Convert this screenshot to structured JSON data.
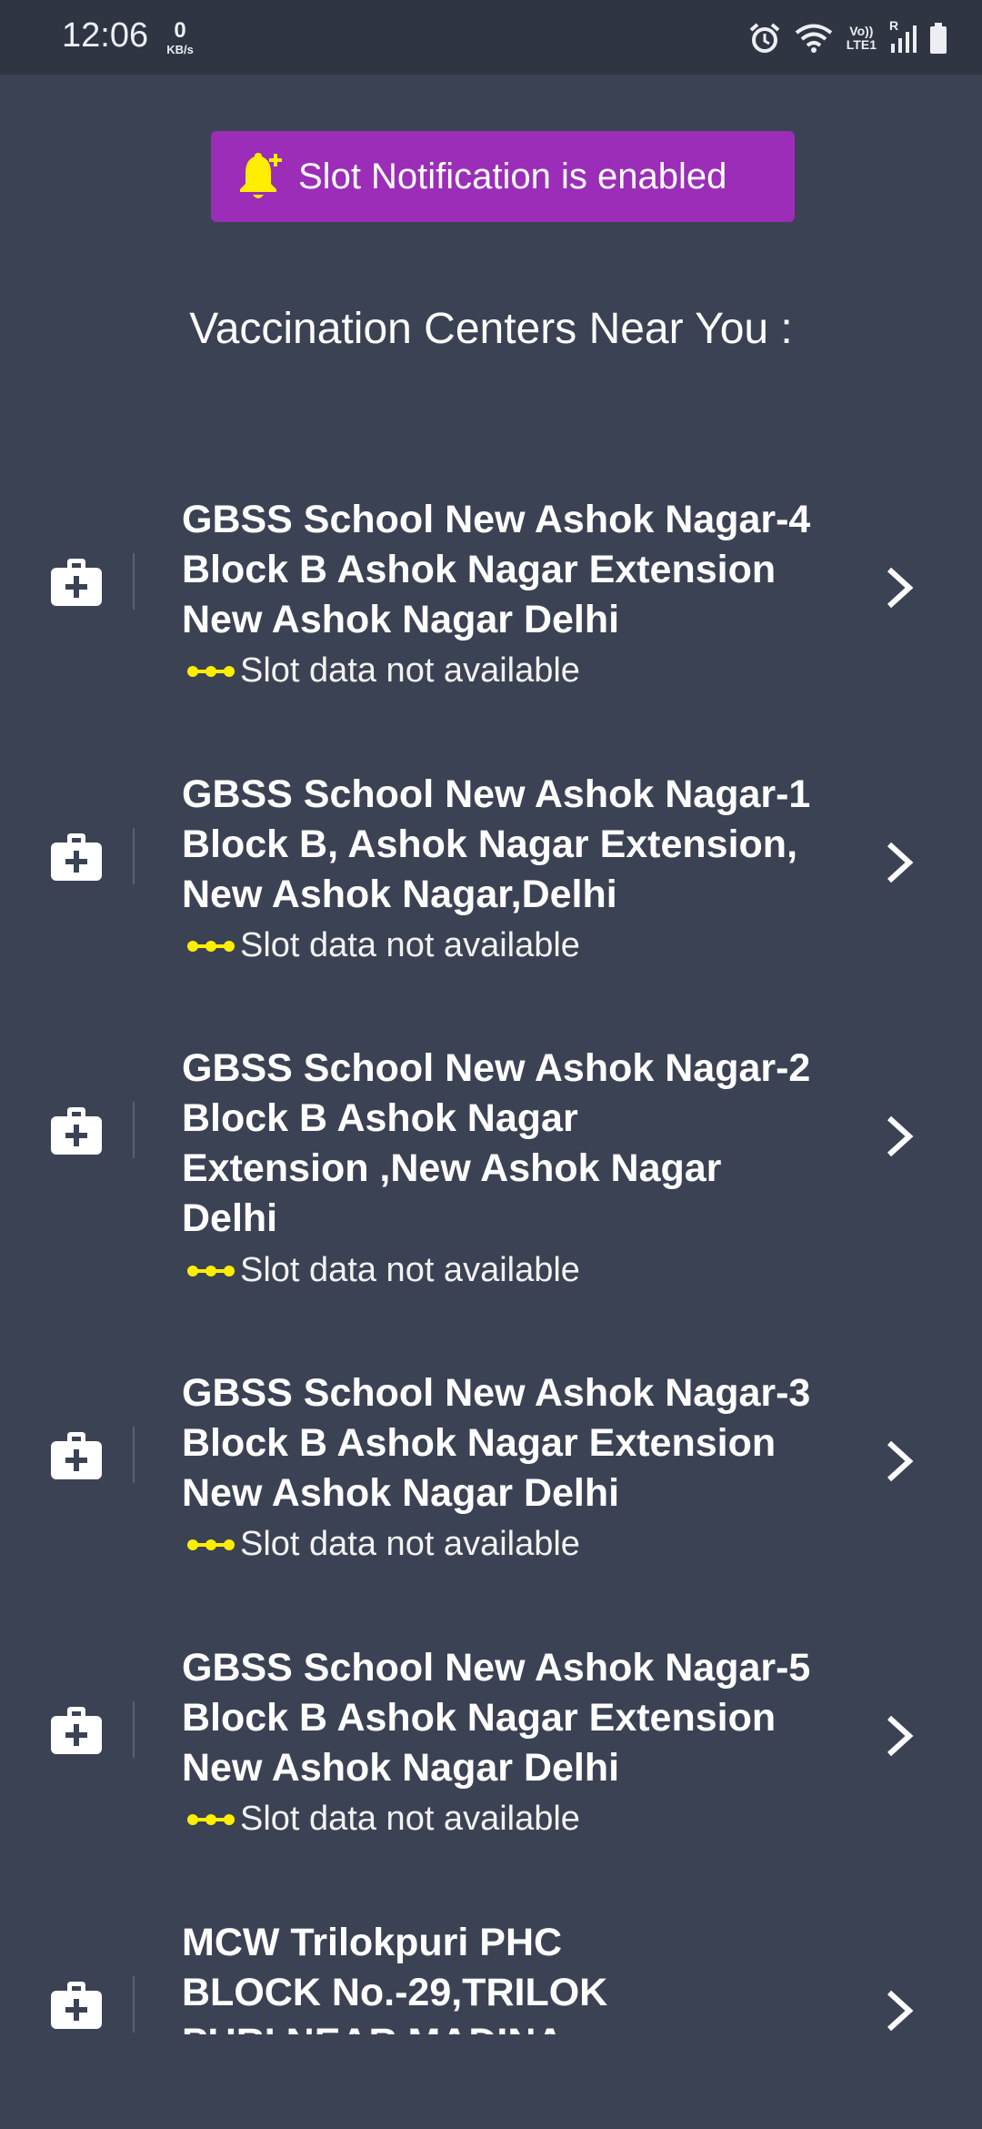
{
  "status_bar": {
    "time": "12:06",
    "net_speed_value": "0",
    "net_speed_unit": "KB/s",
    "network_label_top": "Vo))",
    "network_label_bottom": "LTE1",
    "roaming": "R",
    "icons": [
      "alarm-icon",
      "wifi-icon",
      "signal-icon",
      "battery-icon"
    ]
  },
  "notification": {
    "label": "Slot Notification is enabled",
    "icon": "bell-plus-icon",
    "bg_color": "#9b2db8",
    "icon_color": "#ffee00"
  },
  "section_title": "Vaccination Centers Near You :",
  "centers": [
    {
      "lines": [
        "GBSS School New Ashok Nagar-4",
        "Block B Ashok Nagar Extension",
        "New Ashok Nagar Delhi"
      ],
      "status": "Slot data not available"
    },
    {
      "lines": [
        "GBSS School New Ashok Nagar-1",
        "Block B, Ashok Nagar Extension,",
        "New Ashok Nagar,Delhi"
      ],
      "status": "Slot data not available"
    },
    {
      "lines": [
        "GBSS School New Ashok Nagar-2",
        "Block B Ashok Nagar",
        "Extension ,New Ashok Nagar",
        "Delhi"
      ],
      "status": "Slot data not available"
    },
    {
      "lines": [
        "GBSS School New Ashok Nagar-3",
        "Block B Ashok Nagar Extension",
        "New Ashok Nagar Delhi"
      ],
      "status": "Slot data not available"
    },
    {
      "lines": [
        "GBSS School New Ashok Nagar-5",
        "Block B Ashok Nagar Extension",
        "New Ashok Nagar Delhi"
      ],
      "status": "Slot data not available"
    },
    {
      "lines": [
        "MCW Trilokpuri PHC",
        "BLOCK No.-29,TRILOK",
        "PURI NEAR MADINA"
      ],
      "status": ""
    }
  ],
  "colors": {
    "background": "#3b4253",
    "status_dots": "#ffee00"
  }
}
